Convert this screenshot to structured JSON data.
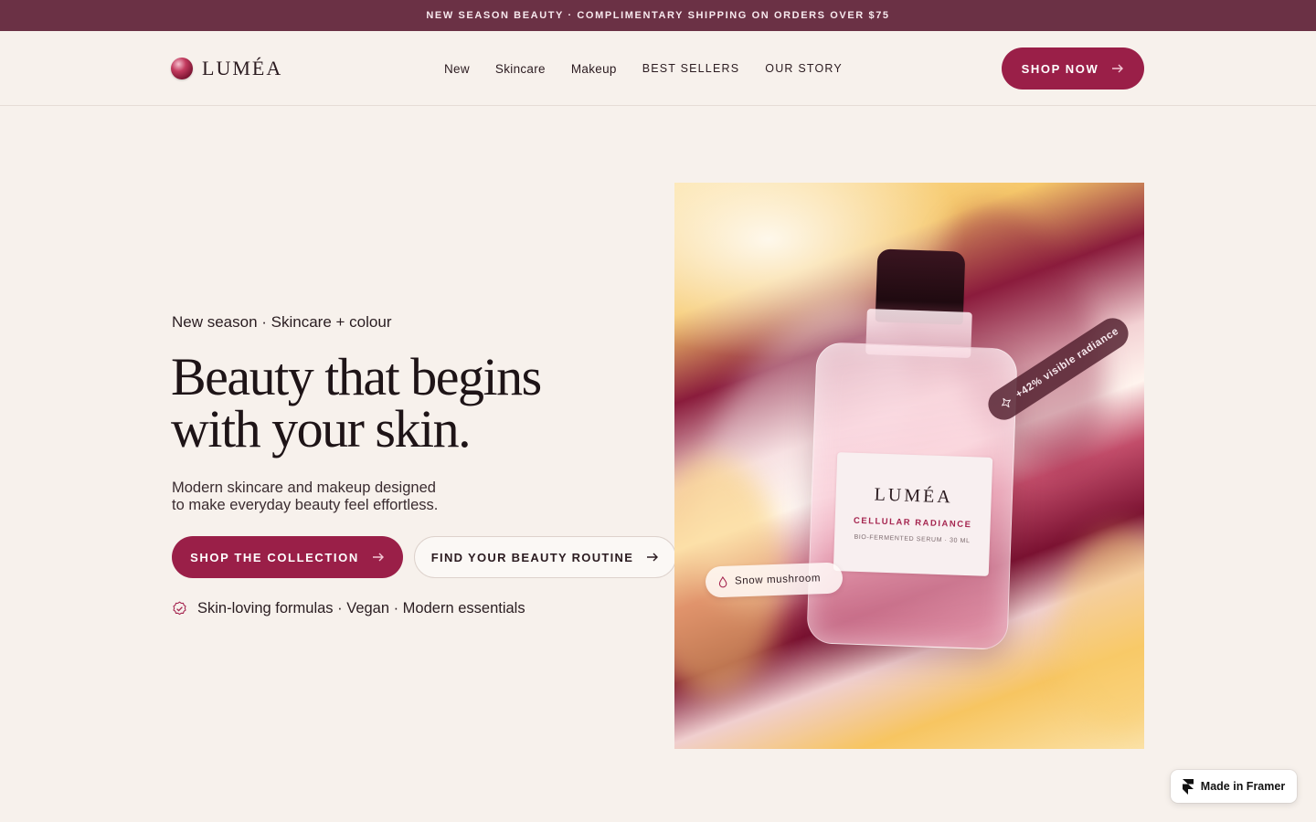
{
  "announcement": {
    "text": "NEW SEASON BEAUTY · COMPLIMENTARY SHIPPING ON ORDERS OVER $75"
  },
  "header": {
    "logo_text": "LUMÉA",
    "nav": [
      {
        "label": "New"
      },
      {
        "label": "Skincare"
      },
      {
        "label": "Makeup"
      },
      {
        "label": "BEST SELLERS"
      },
      {
        "label": "OUR STORY"
      }
    ],
    "cta_label": "SHOP NOW"
  },
  "hero": {
    "eyebrow": "New season · Skincare + colour",
    "headline_line1": "Beauty that begins",
    "headline_line2": "with your skin.",
    "subcopy_line1": "Modern skincare and makeup designed",
    "subcopy_line2": "to make everyday beauty feel effortless.",
    "primary_cta": "SHOP THE COLLECTION",
    "secondary_cta": "FIND YOUR BEAUTY ROUTINE",
    "features": "Skin-loving formulas · Vegan · Modern essentials"
  },
  "product_image": {
    "brand": "LUMÉA",
    "product_name": "CELLULAR RADIANCE",
    "product_desc": "BIO-FERMENTED SERUM · 30 ML",
    "radiance_tag": "+42% visible radiance",
    "ingredient_tag": "Snow mushroom"
  },
  "badge": {
    "label": "Made in Framer"
  },
  "colors": {
    "announcement_bg": "#6b3145",
    "accent": "#9a1f48",
    "page_bg": "#f7f1ec",
    "text": "#1d1416"
  },
  "icons": {
    "logo": "logo-orb-icon",
    "cta_arrow": "arrow-right-icon",
    "feature_check": "check-badge-icon",
    "radiance": "sparkle-icon",
    "ingredient": "droplet-icon",
    "framer": "framer-icon"
  }
}
